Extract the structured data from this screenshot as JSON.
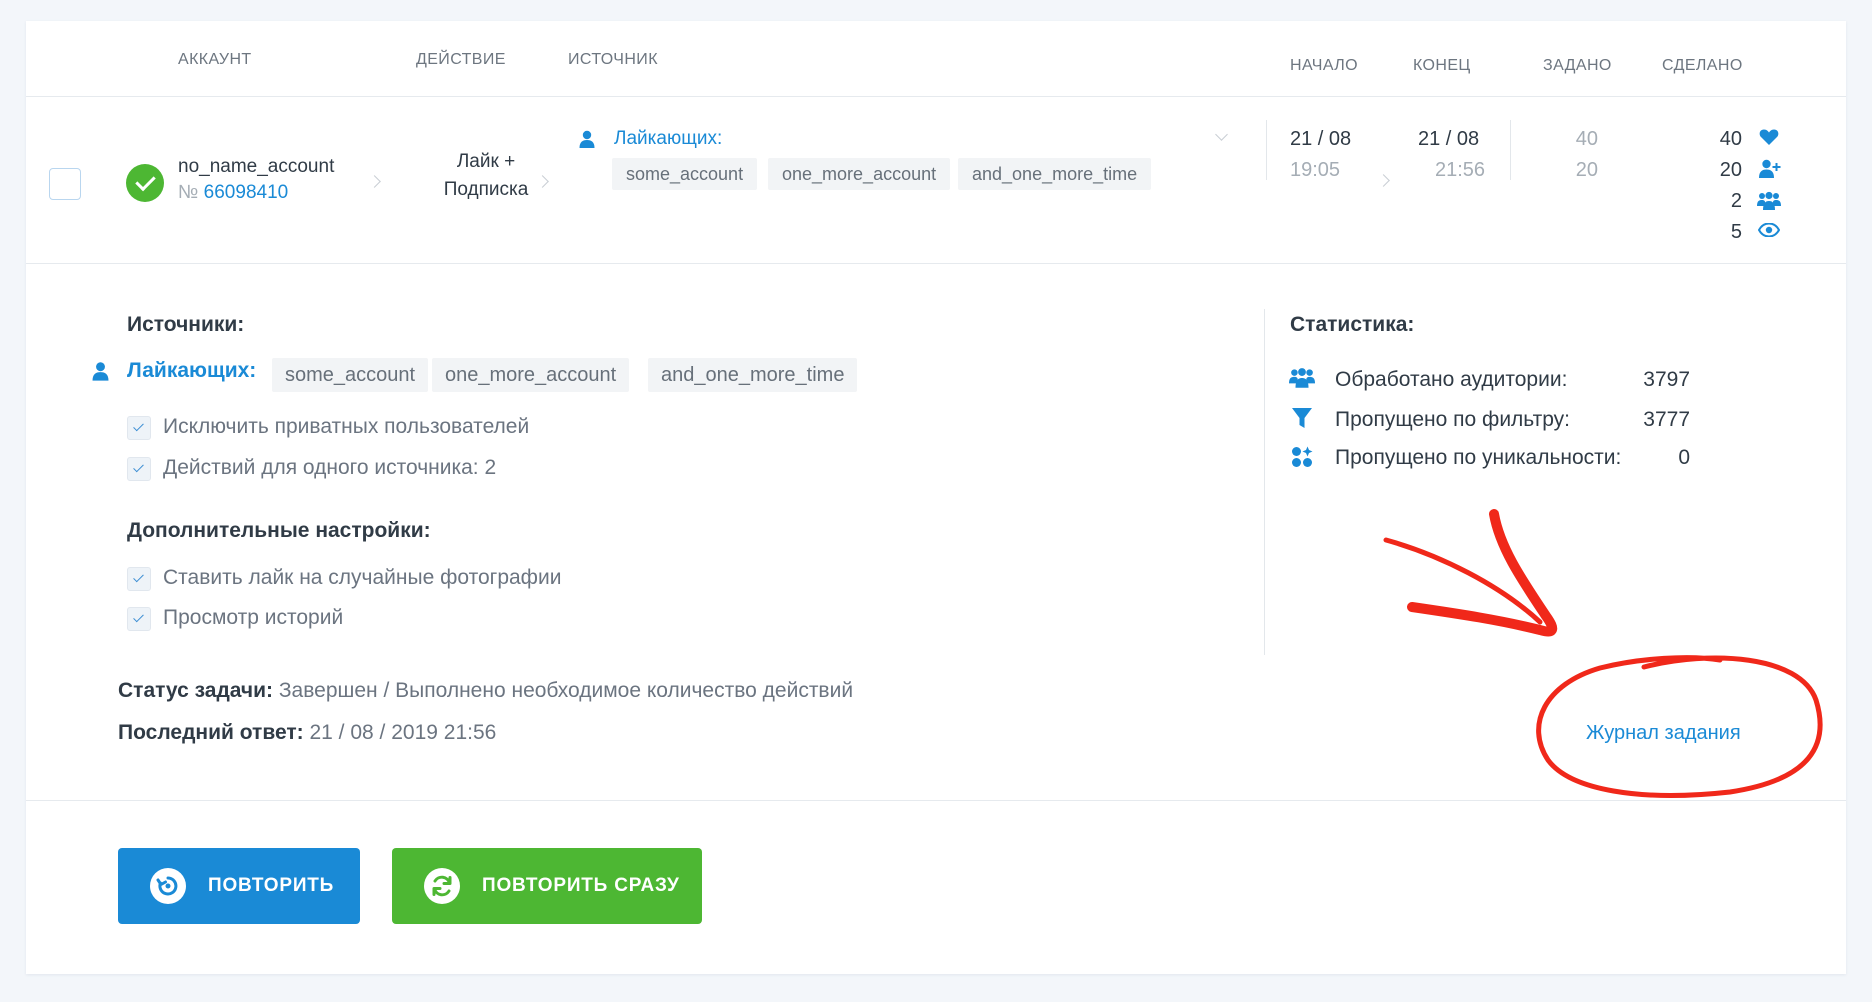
{
  "header": {
    "account": "АККАУНТ",
    "action": "ДЕЙСТВИЕ",
    "source": "ИСТОЧНИК",
    "start": "НАЧАЛО",
    "end": "КОНЕЦ",
    "assigned": "ЗАДАНО",
    "done": "СДЕЛАНО"
  },
  "task": {
    "account_name": "no_name_account",
    "account_no_prefix": "№",
    "account_id": "66098410",
    "action_line1": "Лайк +",
    "action_line2": "Подписка",
    "source_label": "Лайкающих:",
    "source_tags": [
      "some_account",
      "one_more_account",
      "and_one_more_time"
    ],
    "start_date": "21 / 08",
    "start_time": "19:05",
    "end_date": "21 / 08",
    "end_time": "21:56",
    "assigned_1": "40",
    "assigned_2": "20",
    "done_values": [
      "40",
      "20",
      "2",
      "5"
    ],
    "done_icons": [
      "heart-icon",
      "user-plus-icon",
      "users-icon",
      "eye-icon"
    ]
  },
  "details": {
    "sources_title": "Источники:",
    "source_label": "Лайкающих:",
    "source_tags": [
      "some_account",
      "one_more_account",
      "and_one_more_time"
    ],
    "options": [
      "Исключить приватных пользователей",
      "Действий для одного источника: 2"
    ],
    "extra_title": "Дополнительные настройки:",
    "extra_options": [
      "Ставить лайк на случайные фотографии",
      "Просмотр историй"
    ],
    "status_label": "Статус задачи:",
    "status_value": "Завершен / Выполнено необходимое количество действий",
    "last_reply_label": "Последний ответ:",
    "last_reply_value": "21 / 08 / 2019 21:56"
  },
  "stats": {
    "title": "Статистика:",
    "rows": [
      {
        "label": "Обработано аудитории:",
        "value": "3797",
        "icon": "users-icon"
      },
      {
        "label": "Пропущено по фильтру:",
        "value": "3777",
        "icon": "filter-icon"
      },
      {
        "label": "Пропущено по уникальности:",
        "value": "0",
        "icon": "unique-icon"
      }
    ],
    "journal_link": "Журнал задания"
  },
  "buttons": {
    "repeat": "ПОВТОРИТЬ",
    "repeat_now": "ПОВТОРИТЬ СРАЗУ"
  },
  "colors": {
    "accent_blue": "#1a8ad6",
    "success_green": "#4db733",
    "annotation_red": "#f0281a"
  }
}
